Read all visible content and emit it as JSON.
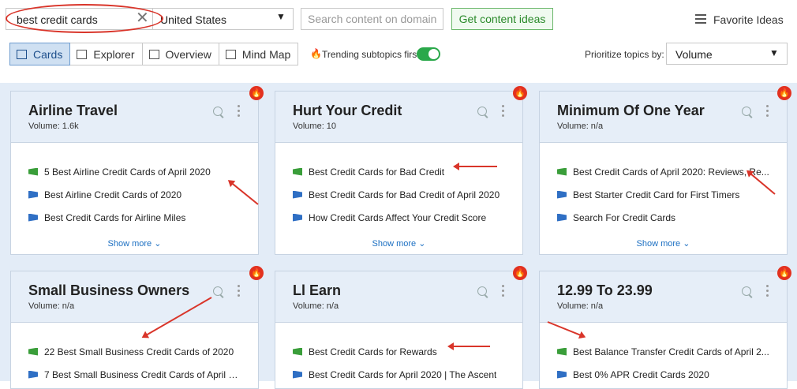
{
  "search": {
    "query": "best credit cards",
    "clear_icon": "close-icon"
  },
  "country": {
    "selected": "United States"
  },
  "domain_search": {
    "placeholder": "Search content on domain"
  },
  "actions": {
    "get_ideas": "Get content ideas",
    "favorite_ideas": "Favorite Ideas"
  },
  "tabs": [
    {
      "label": "Cards",
      "icon": "cards-icon",
      "active": true
    },
    {
      "label": "Explorer",
      "icon": "table-icon",
      "active": false
    },
    {
      "label": "Overview",
      "icon": "overview-icon",
      "active": false
    },
    {
      "label": "Mind Map",
      "icon": "mind-map-icon",
      "active": false
    }
  ],
  "trending": {
    "label": "Trending subtopics first",
    "enabled": true
  },
  "prioritize": {
    "label": "Prioritize topics by:",
    "selected": "Volume"
  },
  "colors": {
    "accent_blue": "#1b6fc2",
    "fire_red": "#e2311f",
    "toggle_green": "#2aa84a",
    "annotation_red": "#d9352a"
  },
  "show_more_label": "Show more",
  "cards": [
    {
      "title": "Airline Travel",
      "volume": "Volume:  1.6k",
      "items": [
        {
          "text": "5 Best Airline Credit Cards of April 2020",
          "type": "green"
        },
        {
          "text": "Best Airline Credit Cards of 2020",
          "type": "blue"
        },
        {
          "text": "Best Credit Cards for Airline Miles",
          "type": "blue"
        }
      ]
    },
    {
      "title": "Hurt Your Credit",
      "volume": "Volume:  10",
      "items": [
        {
          "text": "Best Credit Cards for Bad Credit",
          "type": "green"
        },
        {
          "text": "Best Credit Cards for Bad Credit of April 2020",
          "type": "blue"
        },
        {
          "text": "How Credit Cards Affect Your Credit Score",
          "type": "blue"
        }
      ]
    },
    {
      "title": "Minimum Of One Year",
      "volume": "Volume:  n/a",
      "items": [
        {
          "text": "Best Credit Cards of April 2020: Reviews, Re...",
          "type": "green"
        },
        {
          "text": "Best Starter Credit Card for First Timers",
          "type": "blue"
        },
        {
          "text": "Search For Credit Cards",
          "type": "blue"
        }
      ]
    },
    {
      "title": "Small Business Owners",
      "volume": "Volume:  n/a",
      "items": [
        {
          "text": "22 Best Small Business Credit Cards of 2020",
          "type": "green"
        },
        {
          "text": "7 Best Small Business Credit Cards of April 2...",
          "type": "blue"
        }
      ]
    },
    {
      "title": "Ll Earn",
      "volume": "Volume:  n/a",
      "items": [
        {
          "text": "Best Credit Cards for Rewards",
          "type": "green"
        },
        {
          "text": "Best Credit Cards for April 2020 | The Ascent",
          "type": "blue"
        }
      ]
    },
    {
      "title": "12.99 To 23.99",
      "volume": "Volume:  n/a",
      "items": [
        {
          "text": "Best Balance Transfer Credit Cards of April 2...",
          "type": "green"
        },
        {
          "text": "Best 0% APR Credit Cards 2020",
          "type": "blue"
        }
      ]
    }
  ]
}
